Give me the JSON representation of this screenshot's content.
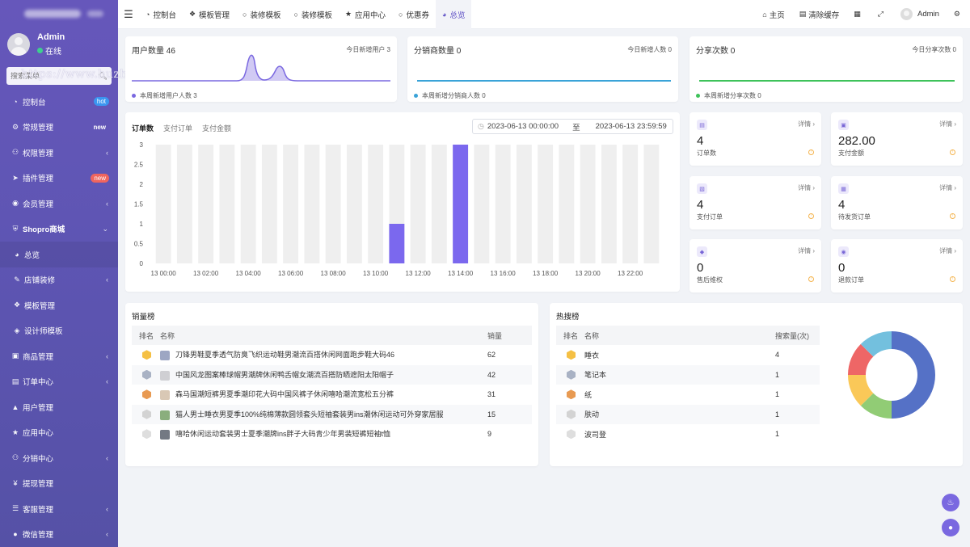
{
  "sidebar": {
    "user": {
      "name": "Admin",
      "status": "在线"
    },
    "search_placeholder": "搜索菜单",
    "items": [
      {
        "label": "控制台",
        "icon": "dashboard-icon",
        "badge": "hot"
      },
      {
        "label": "常规管理",
        "icon": "cogs-icon",
        "badge": "new"
      },
      {
        "label": "权限管理",
        "icon": "users-icon",
        "chevron": true
      },
      {
        "label": "插件管理",
        "icon": "rocket-icon",
        "badge": "new"
      },
      {
        "label": "会员管理",
        "icon": "user-circle-icon",
        "chevron": true
      },
      {
        "label": "Shopro商城",
        "icon": "shield-icon",
        "chevron": true,
        "bold": true
      },
      {
        "label": "总览",
        "icon": "pie-icon",
        "active": true
      },
      {
        "label": "店铺装修",
        "icon": "brush-icon",
        "chevron": true
      },
      {
        "label": "模板管理",
        "icon": "cubes-icon"
      },
      {
        "label": "设计师模板",
        "icon": "cube-icon"
      },
      {
        "label": "商品管理",
        "icon": "goods-icon",
        "chevron": true
      },
      {
        "label": "订单中心",
        "icon": "file-icon",
        "chevron": true
      },
      {
        "label": "用户管理",
        "icon": "user-icon"
      },
      {
        "label": "应用中心",
        "icon": "star-icon"
      },
      {
        "label": "分销中心",
        "icon": "share-icon",
        "chevron": true
      },
      {
        "label": "提现管理",
        "icon": "yen-icon"
      },
      {
        "label": "客服管理",
        "icon": "list-icon",
        "chevron": true
      },
      {
        "label": "微信管理",
        "icon": "wechat-icon",
        "chevron": true
      }
    ]
  },
  "watermark": "https://www.huzhan.com/ishop52942",
  "topnav": {
    "tabs": [
      {
        "label": "控制台",
        "icon": "dashboard-icon"
      },
      {
        "label": "模板管理",
        "icon": "cubes-icon"
      },
      {
        "label": "装修模板",
        "icon": "circle-icon"
      },
      {
        "label": "装修模板",
        "icon": "circle-icon"
      },
      {
        "label": "应用中心",
        "icon": "star-icon"
      },
      {
        "label": "优惠券",
        "icon": "circle-icon"
      },
      {
        "label": "总览",
        "icon": "pie-icon",
        "active": true
      }
    ],
    "home": "主页",
    "clear_cache": "清除缓存",
    "user": "Admin"
  },
  "stats": {
    "users": {
      "title": "用户数量 46",
      "sub": "今日新增用户 3",
      "foot": "本周新增用户人数  3",
      "color": "#7a68e0"
    },
    "agents": {
      "title": "分销商数量 0",
      "sub": "今日新增人数 0",
      "foot": "本周新增分销商人数  0",
      "color": "#3aa3d8"
    },
    "shares": {
      "title": "分享次数 0",
      "sub": "今日分享次数 0",
      "foot": "本周新增分享次数  0",
      "color": "#3ec25a"
    }
  },
  "orders": {
    "tabs": [
      "订单数",
      "支付订单",
      "支付金额"
    ],
    "date_start": "2023-06-13 00:00:00",
    "date_sep": "至",
    "date_end": "2023-06-13 23:59:59"
  },
  "chart_data": {
    "type": "bar",
    "categories": [
      "13 00:00",
      "13 01:00",
      "13 02:00",
      "13 03:00",
      "13 04:00",
      "13 05:00",
      "13 06:00",
      "13 07:00",
      "13 08:00",
      "13 09:00",
      "13 10:00",
      "13 11:00",
      "13 12:00",
      "13 13:00",
      "13 14:00",
      "13 15:00",
      "13 16:00",
      "13 17:00",
      "13 18:00",
      "13 19:00",
      "13 20:00",
      "13 21:00",
      "13 22:00",
      "13 23:00"
    ],
    "x_tick_labels": [
      "13 00:00",
      "13 02:00",
      "13 04:00",
      "13 06:00",
      "13 08:00",
      "13 10:00",
      "13 12:00",
      "13 14:00",
      "13 16:00",
      "13 18:00",
      "13 20:00",
      "13 22:00"
    ],
    "values": [
      0,
      0,
      0,
      0,
      0,
      0,
      0,
      0,
      0,
      0,
      0,
      1,
      0,
      0,
      3,
      0,
      0,
      0,
      0,
      0,
      0,
      0,
      0,
      0
    ],
    "ylim": [
      0,
      3
    ],
    "y_ticks": [
      "0",
      "0.5",
      "1",
      "1.5",
      "2",
      "2.5",
      "3"
    ],
    "bar_color": "#7b68ee",
    "background_bar_color": "#efefef",
    "grid": false
  },
  "kpis": [
    {
      "value": "4",
      "label": "订单数",
      "detail": "详情",
      "icon": "order-icon"
    },
    {
      "value": "282.00",
      "label": "支付金额",
      "detail": "详情",
      "icon": "wallet-icon"
    },
    {
      "value": "4",
      "label": "支付订单",
      "detail": "详情",
      "icon": "paid-icon"
    },
    {
      "value": "4",
      "label": "待发货订单",
      "detail": "详情",
      "icon": "truck-icon"
    },
    {
      "value": "0",
      "label": "售后维权",
      "detail": "详情",
      "icon": "service-icon"
    },
    {
      "value": "0",
      "label": "退款订单",
      "detail": "详情",
      "icon": "refund-icon"
    }
  ],
  "sales_rank": {
    "title": "销量榜",
    "headers": [
      "排名",
      "名称",
      "销量"
    ],
    "rows": [
      {
        "name": "刀锋男鞋夏季透气防臭飞织运动鞋男潮流百搭休闲网面跑步鞋大码46",
        "sales": "62",
        "medal": "#f5c044",
        "thumb": "#9da6c3"
      },
      {
        "name": "中国风龙图案棒球帽男潮牌休闲鸭舌帽女潮流百搭防晒遮阳太阳帽子",
        "sales": "42",
        "medal": "#a9b2c4",
        "thumb": "#cfcfd3"
      },
      {
        "name": "森马国潮短裤男夏季潮印花大码中国风裤子休闲嘻哈潮流宽松五分裤",
        "sales": "31",
        "medal": "#e89a52",
        "thumb": "#d9c8b5"
      },
      {
        "name": "猫人男士睡衣男夏季100%纯棉薄款圆领套头短袖套装男ins潮休闲运动可外穿家居服",
        "sales": "15",
        "medal": "#d3d3d3",
        "thumb": "#8aae7d"
      },
      {
        "name": "嘻哈休闲运动套装男士夏季潮牌ins胖子大码青少年男装短裤短袖t恤",
        "sales": "9",
        "medal": "#dedede",
        "thumb": "#737983"
      }
    ]
  },
  "hot_search": {
    "title": "热搜榜",
    "headers": [
      "排名",
      "名称",
      "搜索量(次)"
    ],
    "rows": [
      {
        "name": "睡衣",
        "count": "4",
        "medal": "#f5c044"
      },
      {
        "name": "笔记本",
        "count": "1",
        "medal": "#a9b2c4"
      },
      {
        "name": "纸",
        "count": "1",
        "medal": "#e89a52"
      },
      {
        "name": "肤动",
        "count": "1",
        "medal": "#d3d3d3"
      },
      {
        "name": "波司登",
        "count": "1",
        "medal": "#dedede"
      }
    ],
    "donut": [
      {
        "value": 4,
        "color": "#5571c6"
      },
      {
        "value": 1,
        "color": "#91cc75"
      },
      {
        "value": 1,
        "color": "#fac858"
      },
      {
        "value": 1,
        "color": "#ee6666"
      },
      {
        "value": 1,
        "color": "#73c0de"
      }
    ]
  }
}
